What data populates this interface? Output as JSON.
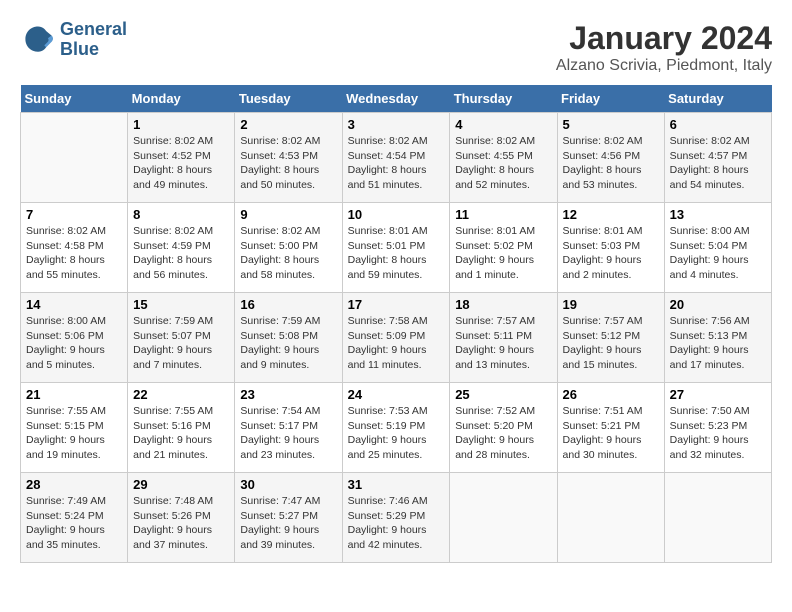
{
  "header": {
    "logo_line1": "General",
    "logo_line2": "Blue",
    "title": "January 2024",
    "location": "Alzano Scrivia, Piedmont, Italy"
  },
  "weekdays": [
    "Sunday",
    "Monday",
    "Tuesday",
    "Wednesday",
    "Thursday",
    "Friday",
    "Saturday"
  ],
  "weeks": [
    [
      {
        "day": "",
        "sunrise": "",
        "sunset": "",
        "daylight": ""
      },
      {
        "day": "1",
        "sunrise": "Sunrise: 8:02 AM",
        "sunset": "Sunset: 4:52 PM",
        "daylight": "Daylight: 8 hours and 49 minutes."
      },
      {
        "day": "2",
        "sunrise": "Sunrise: 8:02 AM",
        "sunset": "Sunset: 4:53 PM",
        "daylight": "Daylight: 8 hours and 50 minutes."
      },
      {
        "day": "3",
        "sunrise": "Sunrise: 8:02 AM",
        "sunset": "Sunset: 4:54 PM",
        "daylight": "Daylight: 8 hours and 51 minutes."
      },
      {
        "day": "4",
        "sunrise": "Sunrise: 8:02 AM",
        "sunset": "Sunset: 4:55 PM",
        "daylight": "Daylight: 8 hours and 52 minutes."
      },
      {
        "day": "5",
        "sunrise": "Sunrise: 8:02 AM",
        "sunset": "Sunset: 4:56 PM",
        "daylight": "Daylight: 8 hours and 53 minutes."
      },
      {
        "day": "6",
        "sunrise": "Sunrise: 8:02 AM",
        "sunset": "Sunset: 4:57 PM",
        "daylight": "Daylight: 8 hours and 54 minutes."
      }
    ],
    [
      {
        "day": "7",
        "sunrise": "Sunrise: 8:02 AM",
        "sunset": "Sunset: 4:58 PM",
        "daylight": "Daylight: 8 hours and 55 minutes."
      },
      {
        "day": "8",
        "sunrise": "Sunrise: 8:02 AM",
        "sunset": "Sunset: 4:59 PM",
        "daylight": "Daylight: 8 hours and 56 minutes."
      },
      {
        "day": "9",
        "sunrise": "Sunrise: 8:02 AM",
        "sunset": "Sunset: 5:00 PM",
        "daylight": "Daylight: 8 hours and 58 minutes."
      },
      {
        "day": "10",
        "sunrise": "Sunrise: 8:01 AM",
        "sunset": "Sunset: 5:01 PM",
        "daylight": "Daylight: 8 hours and 59 minutes."
      },
      {
        "day": "11",
        "sunrise": "Sunrise: 8:01 AM",
        "sunset": "Sunset: 5:02 PM",
        "daylight": "Daylight: 9 hours and 1 minute."
      },
      {
        "day": "12",
        "sunrise": "Sunrise: 8:01 AM",
        "sunset": "Sunset: 5:03 PM",
        "daylight": "Daylight: 9 hours and 2 minutes."
      },
      {
        "day": "13",
        "sunrise": "Sunrise: 8:00 AM",
        "sunset": "Sunset: 5:04 PM",
        "daylight": "Daylight: 9 hours and 4 minutes."
      }
    ],
    [
      {
        "day": "14",
        "sunrise": "Sunrise: 8:00 AM",
        "sunset": "Sunset: 5:06 PM",
        "daylight": "Daylight: 9 hours and 5 minutes."
      },
      {
        "day": "15",
        "sunrise": "Sunrise: 7:59 AM",
        "sunset": "Sunset: 5:07 PM",
        "daylight": "Daylight: 9 hours and 7 minutes."
      },
      {
        "day": "16",
        "sunrise": "Sunrise: 7:59 AM",
        "sunset": "Sunset: 5:08 PM",
        "daylight": "Daylight: 9 hours and 9 minutes."
      },
      {
        "day": "17",
        "sunrise": "Sunrise: 7:58 AM",
        "sunset": "Sunset: 5:09 PM",
        "daylight": "Daylight: 9 hours and 11 minutes."
      },
      {
        "day": "18",
        "sunrise": "Sunrise: 7:57 AM",
        "sunset": "Sunset: 5:11 PM",
        "daylight": "Daylight: 9 hours and 13 minutes."
      },
      {
        "day": "19",
        "sunrise": "Sunrise: 7:57 AM",
        "sunset": "Sunset: 5:12 PM",
        "daylight": "Daylight: 9 hours and 15 minutes."
      },
      {
        "day": "20",
        "sunrise": "Sunrise: 7:56 AM",
        "sunset": "Sunset: 5:13 PM",
        "daylight": "Daylight: 9 hours and 17 minutes."
      }
    ],
    [
      {
        "day": "21",
        "sunrise": "Sunrise: 7:55 AM",
        "sunset": "Sunset: 5:15 PM",
        "daylight": "Daylight: 9 hours and 19 minutes."
      },
      {
        "day": "22",
        "sunrise": "Sunrise: 7:55 AM",
        "sunset": "Sunset: 5:16 PM",
        "daylight": "Daylight: 9 hours and 21 minutes."
      },
      {
        "day": "23",
        "sunrise": "Sunrise: 7:54 AM",
        "sunset": "Sunset: 5:17 PM",
        "daylight": "Daylight: 9 hours and 23 minutes."
      },
      {
        "day": "24",
        "sunrise": "Sunrise: 7:53 AM",
        "sunset": "Sunset: 5:19 PM",
        "daylight": "Daylight: 9 hours and 25 minutes."
      },
      {
        "day": "25",
        "sunrise": "Sunrise: 7:52 AM",
        "sunset": "Sunset: 5:20 PM",
        "daylight": "Daylight: 9 hours and 28 minutes."
      },
      {
        "day": "26",
        "sunrise": "Sunrise: 7:51 AM",
        "sunset": "Sunset: 5:21 PM",
        "daylight": "Daylight: 9 hours and 30 minutes."
      },
      {
        "day": "27",
        "sunrise": "Sunrise: 7:50 AM",
        "sunset": "Sunset: 5:23 PM",
        "daylight": "Daylight: 9 hours and 32 minutes."
      }
    ],
    [
      {
        "day": "28",
        "sunrise": "Sunrise: 7:49 AM",
        "sunset": "Sunset: 5:24 PM",
        "daylight": "Daylight: 9 hours and 35 minutes."
      },
      {
        "day": "29",
        "sunrise": "Sunrise: 7:48 AM",
        "sunset": "Sunset: 5:26 PM",
        "daylight": "Daylight: 9 hours and 37 minutes."
      },
      {
        "day": "30",
        "sunrise": "Sunrise: 7:47 AM",
        "sunset": "Sunset: 5:27 PM",
        "daylight": "Daylight: 9 hours and 39 minutes."
      },
      {
        "day": "31",
        "sunrise": "Sunrise: 7:46 AM",
        "sunset": "Sunset: 5:29 PM",
        "daylight": "Daylight: 9 hours and 42 minutes."
      },
      {
        "day": "",
        "sunrise": "",
        "sunset": "",
        "daylight": ""
      },
      {
        "day": "",
        "sunrise": "",
        "sunset": "",
        "daylight": ""
      },
      {
        "day": "",
        "sunrise": "",
        "sunset": "",
        "daylight": ""
      }
    ]
  ]
}
